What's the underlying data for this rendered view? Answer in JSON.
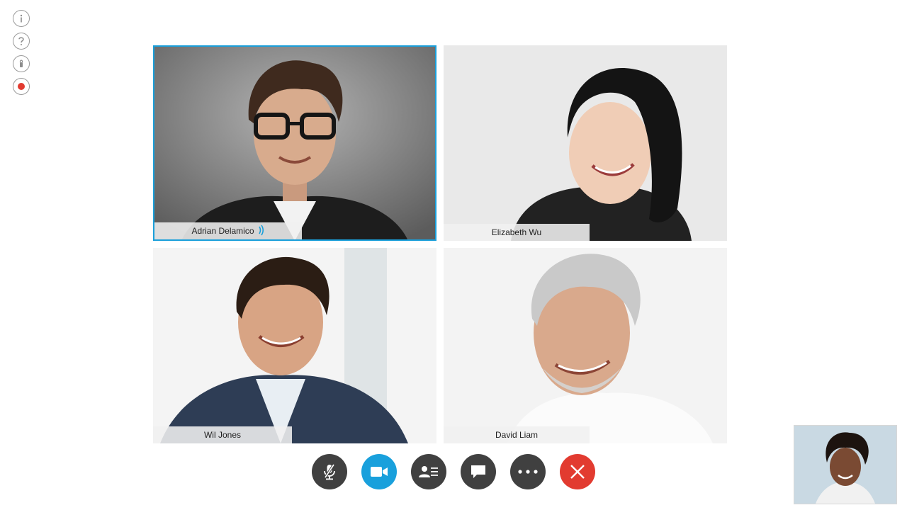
{
  "rail": {
    "items": [
      {
        "name": "info-icon"
      },
      {
        "name": "help-icon"
      },
      {
        "name": "lock-icon"
      },
      {
        "name": "record-icon"
      }
    ]
  },
  "participants": [
    {
      "name": "Adrian Delamico",
      "speaking": true
    },
    {
      "name": "Elizabeth Wu",
      "speaking": false
    },
    {
      "name": "Wil Jones",
      "speaking": false
    },
    {
      "name": "David Liam",
      "speaking": false
    }
  ],
  "controls": [
    {
      "name": "mute-button",
      "icon": "mic-muted-icon"
    },
    {
      "name": "video-button",
      "icon": "camera-icon"
    },
    {
      "name": "participants-button",
      "icon": "contact-list-icon"
    },
    {
      "name": "chat-button",
      "icon": "chat-bubble-icon"
    },
    {
      "name": "more-button",
      "icon": "ellipsis-icon"
    },
    {
      "name": "end-call-button",
      "icon": "close-icon"
    }
  ],
  "colors": {
    "accent": "#1a9fda",
    "end_call": "#e23b30",
    "control_bg": "#404040",
    "record": "#e23b30"
  }
}
